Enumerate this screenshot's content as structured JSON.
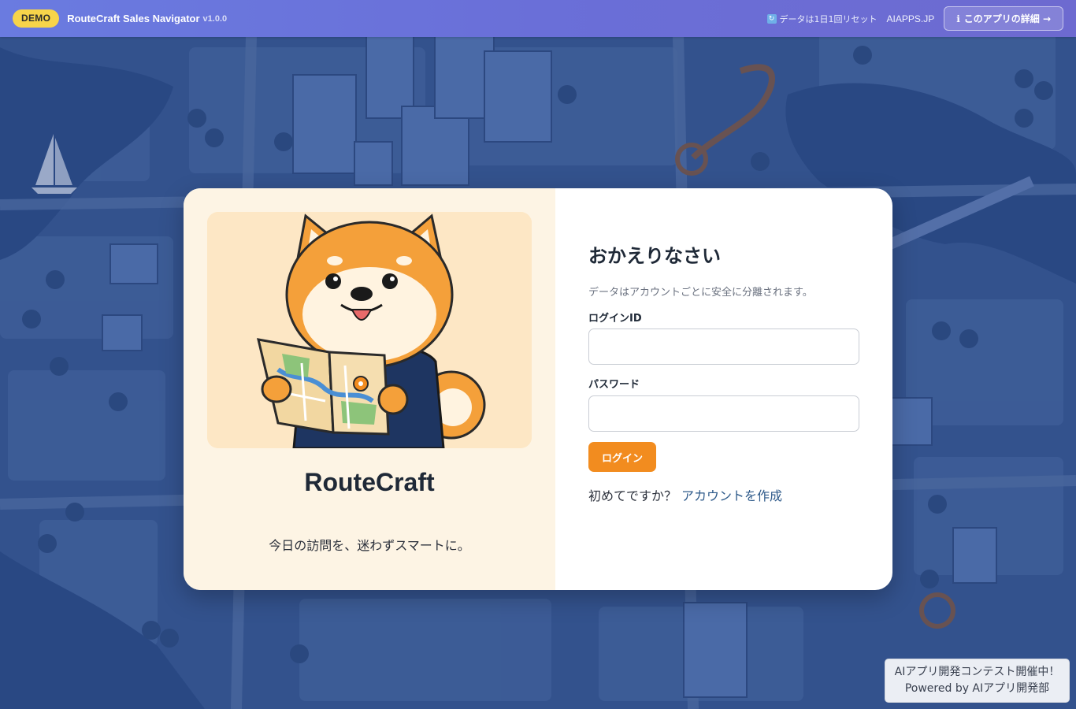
{
  "topbar": {
    "badge": "DEMO",
    "app_name": "RouteCraft Sales Navigator",
    "version": "v1.0.0",
    "reset_note": "データは1日1回リセット",
    "reset_icon": "refresh-icon",
    "site_link": "AIAPPS.JP",
    "about_button": "このアプリの詳細 →",
    "about_icon": "info-icon",
    "badge_color": "#f7d44a",
    "bar_color": "#6a73dc"
  },
  "card": {
    "mascot": "shiba-dog-with-map-illustration",
    "brand_title": "RouteCraft",
    "tagline": "今日の訪問を、迷わずスマートに。",
    "welcome": "おかえりなさい",
    "subtext": "データはアカウントごとに安全に分離されます。",
    "login_id_label": "ログインID",
    "login_id_value": "",
    "password_label": "パスワード",
    "password_value": "",
    "login_button": "ログイン",
    "signup_prompt": "初めてですか？",
    "signup_link": "アカウントを作成",
    "accent_color": "#f28c1f"
  },
  "footer": {
    "contest_line1": "AIアプリ開発コンテスト開催中！",
    "contest_line2": "Powered by AIアプリ開発部"
  }
}
